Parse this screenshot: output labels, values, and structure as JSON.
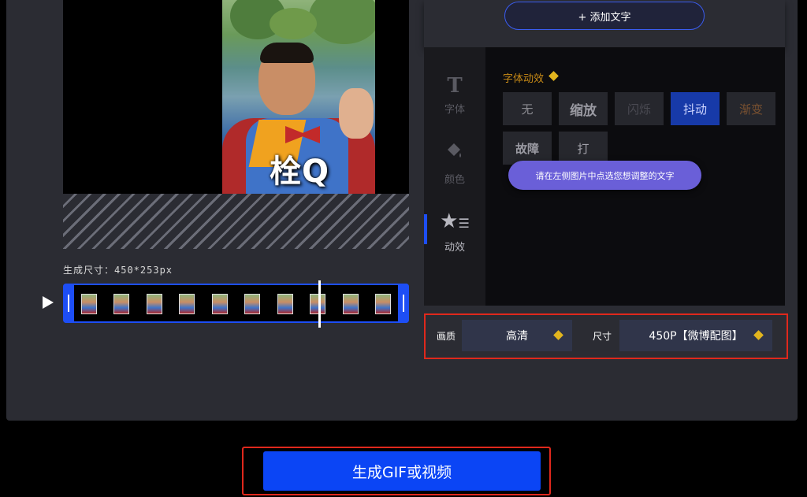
{
  "preview": {
    "overlay_text": "栓Q",
    "size_label": "生成尺寸：450*253px"
  },
  "right_panel": {
    "add_text_button": "+ 添加文字",
    "nav": [
      {
        "label": "字体",
        "icon": "text-icon"
      },
      {
        "label": "颜色",
        "icon": "paint-bucket-icon"
      },
      {
        "label": "动效",
        "icon": "star-icon",
        "active": true
      }
    ],
    "effect_section_title": "字体动效",
    "effects": [
      "无",
      "缩放",
      "闪烁",
      "抖动",
      "渐变",
      "故障",
      "打"
    ],
    "active_effect": "抖动",
    "tooltip": "请在左侧图片中点选您想调整的文字"
  },
  "quality": {
    "quality_label": "画质",
    "quality_value": "高清",
    "size_label": "尺寸",
    "size_value": "450P【微博配图】"
  },
  "generate_button": "生成GIF或视频",
  "colors": {
    "accent_blue": "#0b45f5",
    "highlight_red": "#e0281c",
    "vip_gold": "#e2b51e",
    "panel_bg": "#2b2c33"
  }
}
